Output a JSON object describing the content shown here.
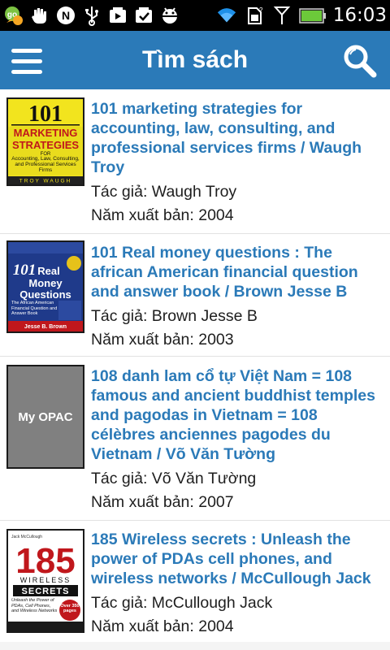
{
  "status_bar": {
    "time": "16:03",
    "icons": [
      "talk-icon",
      "hand-icon",
      "n-icon",
      "usb-icon",
      "play-icon",
      "check-download-icon",
      "android-debug-icon",
      "wifi-icon",
      "sim-icon",
      "signal-icon",
      "battery-icon"
    ]
  },
  "app_bar": {
    "title": "Tìm sách",
    "menu_icon": "hamburger-menu-icon",
    "search_icon": "search-icon"
  },
  "colors": {
    "app_bar": "#2b7ab8",
    "title_link": "#2b7ab8",
    "status_bar": "#000000",
    "text": "#1e1e1e"
  },
  "books": [
    {
      "title": "101 marketing strategies for accounting, law, consulting, and professional services firms / Waugh Troy",
      "author_label": "Tác giả: Waugh Troy",
      "year_label": "Năm xuất bản: 2004",
      "cover": {
        "line1": "101",
        "line2": "MARKETING",
        "line3": "STRATEGIES",
        "line4": "FOR",
        "line5": "Accounting, Law, Consulting, and Professional Services Firms",
        "line6": "TROY WAUGH"
      }
    },
    {
      "title": "101 Real money questions : The african American financial question and answer book / Brown Jesse B",
      "author_label": "Tác giả: Brown Jesse B",
      "year_label": "Năm xuất bản: 2003",
      "cover": {
        "line1": "101",
        "line2": "Real",
        "line3": "Money",
        "line4": "Questions",
        "line5": "The African American Financial Question and Answer Book",
        "line6": "Jesse B. Brown"
      }
    },
    {
      "title": "108 danh lam cổ tự Việt Nam = 108 famous and ancient buddhist temples and pagodas in Vietnam = 108 célèbres anciennes pagodes du Vietnam / Võ Văn Tường",
      "author_label": "Tác giả: Võ Văn Tường",
      "year_label": "Năm xuất bản: 2007",
      "cover": {
        "placeholder": "My OPAC"
      }
    },
    {
      "title": "185 Wireless secrets : Unleash the power of PDAs cell phones, and wireless networks / McCullough Jack",
      "author_label": "Tác giả: McCullough Jack",
      "year_label": "Năm xuất bản: 2004",
      "cover": {
        "line1": "185",
        "line2": "WIRELESS",
        "line3": "SECRETS",
        "line4": "Unleash the Power of PDAs, Cell Phones, and Wireless Networks",
        "line5": "Over 350 pages",
        "line6": "Jack McCullough"
      }
    }
  ]
}
